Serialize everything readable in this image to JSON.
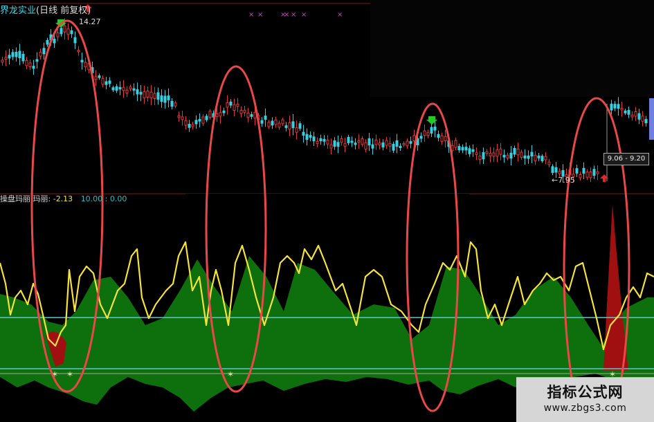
{
  "header": {
    "stock_name": "界龙实业",
    "period": "(日线 前复权)"
  },
  "indicator": {
    "name": "操盘玛丽",
    "label": "玛丽:",
    "value": "-2.13",
    "values2": "10.00 : 0.00"
  },
  "price_marks": {
    "high_label": "14.27",
    "low_label": "←7.95",
    "range_label": "9.06 - 9.20"
  },
  "watermark": {
    "main": "指标公式网",
    "url": "www.zbgs3.com"
  },
  "colors": {
    "up_candle": "#e03838",
    "down_candle": "#38d0e0",
    "indicator_line": "#f5e23b",
    "indicator_fill_green": "#0e7a0e",
    "indicator_fill_red": "#a01010",
    "reference_lines": "#5fc8cc",
    "highlight_ellipse": "#e84848",
    "buy_arrow": "#22cc22",
    "sell_arrow": "#ee2222",
    "signal_marks": "#cc44cc"
  },
  "icons": [
    "buy-arrow-icon",
    "sell-arrow-icon",
    "signal-x-icon",
    "star-marker-icon"
  ]
}
